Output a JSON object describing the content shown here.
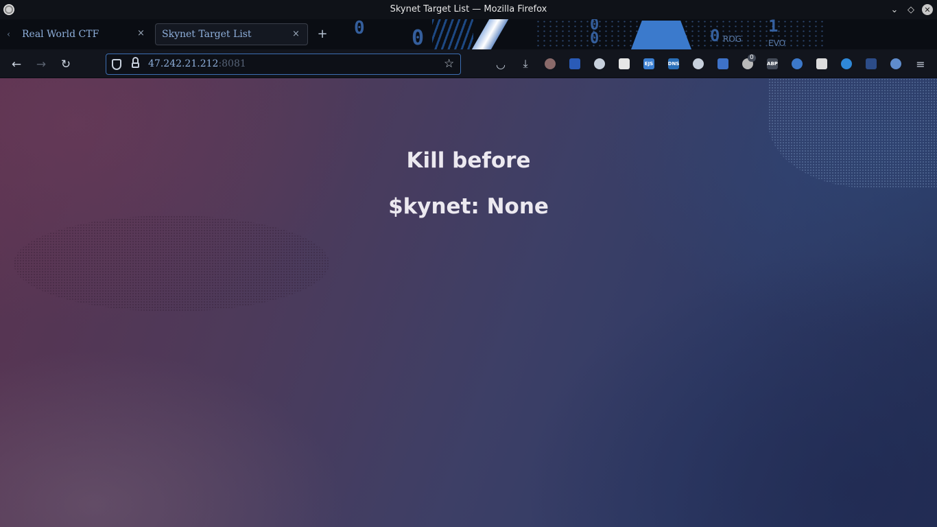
{
  "window": {
    "title": "Skynet Target List — Mozilla Firefox",
    "controls": {
      "minimize": "⌄",
      "maximize": "◇",
      "close": "✕"
    }
  },
  "tabs": [
    {
      "label": "Real World CTF",
      "active": false
    },
    {
      "label": "Skynet Target List",
      "active": true
    }
  ],
  "tab_strip": {
    "scroll_left": "‹",
    "close_glyph": "×",
    "new_tab_glyph": "+"
  },
  "theme_art": {
    "numbers": [
      "0",
      "0",
      "0",
      "0",
      "1",
      "0"
    ],
    "labels": [
      "ROG",
      "EVO"
    ]
  },
  "navbar": {
    "back_glyph": "←",
    "forward_glyph": "→",
    "reload_glyph": "↻",
    "url_host": "47.242.21.212",
    "url_port": ":8081",
    "bookmark_glyph": "☆"
  },
  "extensions": [
    {
      "name": "pocket-icon",
      "glyph": "◡",
      "color": "#c7d0dc"
    },
    {
      "name": "downloads-icon",
      "glyph": "⤓",
      "color": "#c7d0dc"
    },
    {
      "name": "tampermonkey-icon",
      "glyph": "",
      "color": "#8a6a6a"
    },
    {
      "name": "shield-extension-icon",
      "glyph": "",
      "color": "#2a5bb7"
    },
    {
      "name": "agent-icon",
      "glyph": "",
      "color": "#c7d0dc"
    },
    {
      "name": "notes-icon",
      "glyph": "",
      "color": "#e6e6e6"
    },
    {
      "name": "ejs-icon",
      "glyph": "EJS",
      "color": "#3b7fd1"
    },
    {
      "name": "dns-icon",
      "glyph": "DNS",
      "color": "#2a6fb8"
    },
    {
      "name": "circle-extension-icon",
      "glyph": "",
      "color": "#c7d0dc"
    },
    {
      "name": "clipboard-icon",
      "glyph": "",
      "color": "#3e72c8"
    },
    {
      "name": "ublock-icon",
      "glyph": "",
      "color": "#b9b9b9"
    },
    {
      "name": "abp-icon",
      "glyph": "ABP",
      "color": "#444b58"
    },
    {
      "name": "translate-icon",
      "glyph": "",
      "color": "#3c78c9"
    },
    {
      "name": "mask-icon",
      "glyph": "",
      "color": "#dcdcdc"
    },
    {
      "name": "refresh-extension-icon",
      "glyph": "",
      "color": "#2f88d8"
    },
    {
      "name": "diamond-extension-icon",
      "glyph": "",
      "color": "#2c4c88"
    },
    {
      "name": "globe-extension-icon",
      "glyph": "",
      "color": "#5f8ccc"
    },
    {
      "name": "menu-icon",
      "glyph": "≡",
      "color": "#c7d0dc"
    }
  ],
  "extension_badge": "0",
  "page": {
    "heading_1": "Kill before",
    "heading_2": "$kynet: None"
  }
}
